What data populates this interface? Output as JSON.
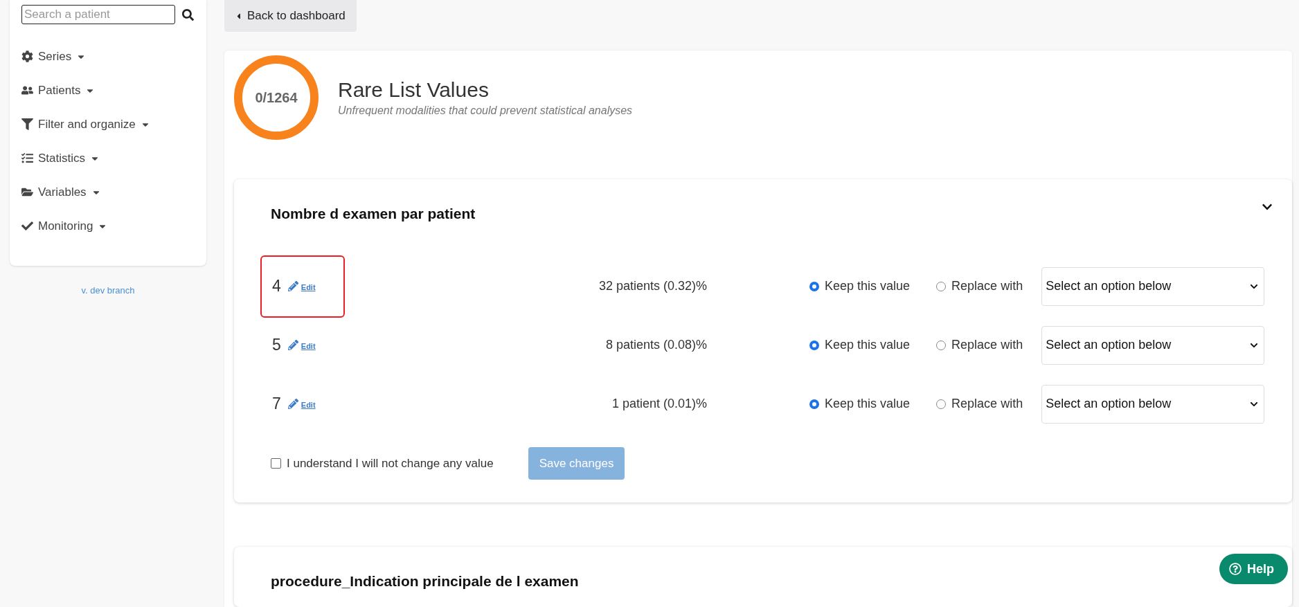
{
  "sidebar": {
    "search": {
      "placeholder": "Search a patient"
    },
    "items": [
      {
        "kind": "gear",
        "label": "Series"
      },
      {
        "kind": "users",
        "label": "Patients"
      },
      {
        "kind": "filter",
        "label": "Filter and organize"
      },
      {
        "kind": "checklist",
        "label": "Statistics"
      },
      {
        "kind": "folder",
        "label": "Variables"
      },
      {
        "kind": "check",
        "label": "Monitoring"
      }
    ],
    "version": "v. dev branch"
  },
  "back_button": "Back to dashboard",
  "header": {
    "counter": "0/1264",
    "title": "Rare List Values",
    "subtitle": "Unfrequent modalities that could prevent statistical analyses"
  },
  "sections": [
    {
      "title": "Nombre d examen par patient",
      "expanded": true,
      "rows": [
        {
          "value": "4",
          "edit": "Edit",
          "highlighted": true,
          "count": "32 patients (0.32)%",
          "keep": {
            "label": "Keep this value",
            "selected": true
          },
          "replace": {
            "label": "Replace with",
            "selected": false
          },
          "select": "Select an option below"
        },
        {
          "value": "5",
          "edit": "Edit",
          "highlighted": false,
          "count": "8 patients (0.08)%",
          "keep": {
            "label": "Keep this value",
            "selected": true
          },
          "replace": {
            "label": "Replace with",
            "selected": false
          },
          "select": "Select an option below"
        },
        {
          "value": "7",
          "edit": "Edit",
          "highlighted": false,
          "count": "1 patient (0.01)%",
          "keep": {
            "label": "Keep this value",
            "selected": true
          },
          "replace": {
            "label": "Replace with",
            "selected": false
          },
          "select": "Select an option below"
        }
      ],
      "confirm": {
        "label": "I understand I will not change any value",
        "checked": false
      },
      "save": "Save changes"
    },
    {
      "title": "procedure_Indication principale de l examen"
    }
  ],
  "help": "Help"
}
